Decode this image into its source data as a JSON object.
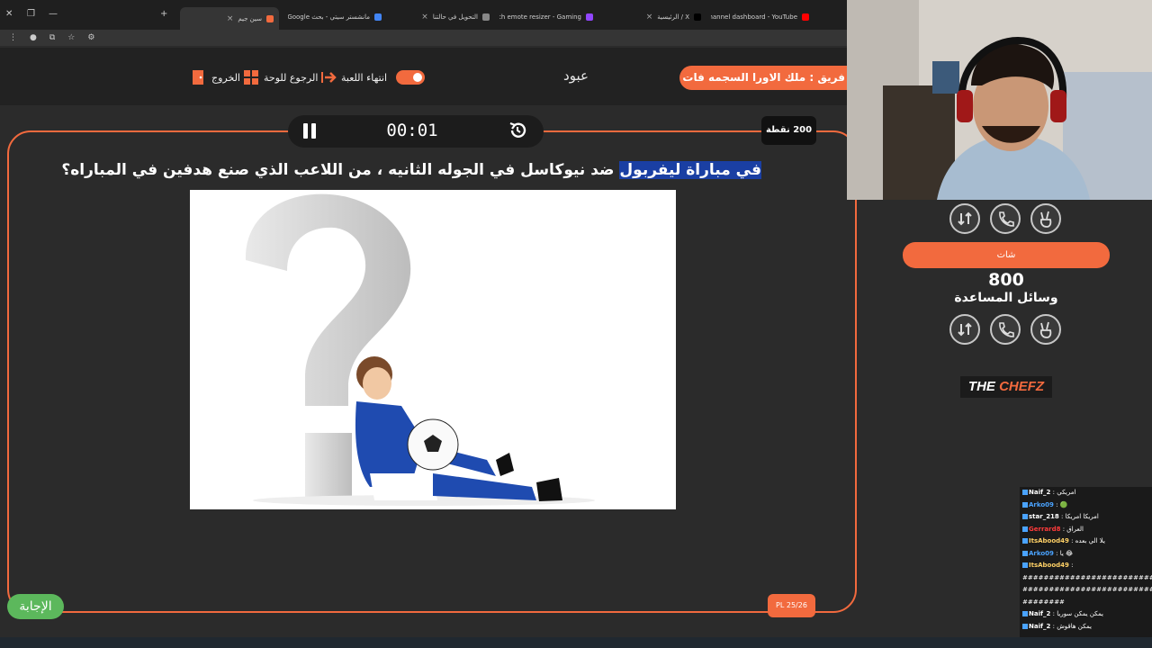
{
  "browser": {
    "tabs": [
      {
        "label": "",
        "color": "#e55"
      },
      {
        "label": "",
        "color": "#4285f4"
      },
      {
        "label": "سين جيم",
        "color": "#f26a3e",
        "active": true
      },
      {
        "label": "مانشستر سيتي - بحث Google",
        "color": "#4285f4"
      },
      {
        "label": "التحويل في حالتنا",
        "color": "#888"
      },
      {
        "label": "Twitch emote resizer - Gaming",
        "color": "#9146ff"
      },
      {
        "label": "X / الرئيسية",
        "color": "#000"
      },
      {
        "label": "Channel dashboard - YouTube",
        "color": "#f00"
      }
    ]
  },
  "header": {
    "team1": "فريق : ملك الاورا السجمه فات",
    "player_name": "عبود",
    "end_game": "انتهاء اللعبة",
    "back_to_board": "الرجوع للوحة",
    "exit": "الخروج"
  },
  "game": {
    "timer": "00:01",
    "points": "200 نقطة",
    "question_highlight": "في مباراة ليفربول",
    "question_rest": " ضد نيوكاسل في الجوله الثانيه ، من اللاعب الذي صنع هدفين في المباراه؟",
    "answer_label": "الإجابة",
    "level": "PL 25/26"
  },
  "team2": {
    "name": "شات",
    "score": "800",
    "helps_label": "وسائل المساعدة"
  },
  "logo": {
    "part1": "THE",
    "part2": "CHEFZ"
  },
  "chat": [
    {
      "user": "Naif_2",
      "color": "#fff",
      "msg": ": امريكي"
    },
    {
      "user": "Arko09",
      "color": "#4aa3ff",
      "msg": ": 🟢"
    },
    {
      "user": "star_218",
      "color": "#fff",
      "msg": ": امريكا امريكا"
    },
    {
      "user": "Gerrard8",
      "color": "#ff3b3b",
      "msg": ": العراق"
    },
    {
      "user": "ItsAbood49",
      "color": "#ffd166",
      "msg": ": يلا الي بعده"
    },
    {
      "user": "Arko09",
      "color": "#4aa3ff",
      "msg": ": يا 😂"
    },
    {
      "user": "ItsAbood49",
      "color": "#ffd166",
      "msg": ":"
    },
    {
      "user": "",
      "color": "#fff",
      "msg": "#################################"
    },
    {
      "user": "",
      "color": "#fff",
      "msg": "#################################"
    },
    {
      "user": "",
      "color": "#fff",
      "msg": "########"
    },
    {
      "user": "Naif_2",
      "color": "#fff",
      "msg": ": يمكن يمكن سوريا"
    },
    {
      "user": "Naif_2",
      "color": "#fff",
      "msg": ": يمكن هاقوش"
    }
  ],
  "colors": {
    "accent": "#f26a3e",
    "answer": "#5cb85c",
    "highlight": "#1a3fa3"
  }
}
